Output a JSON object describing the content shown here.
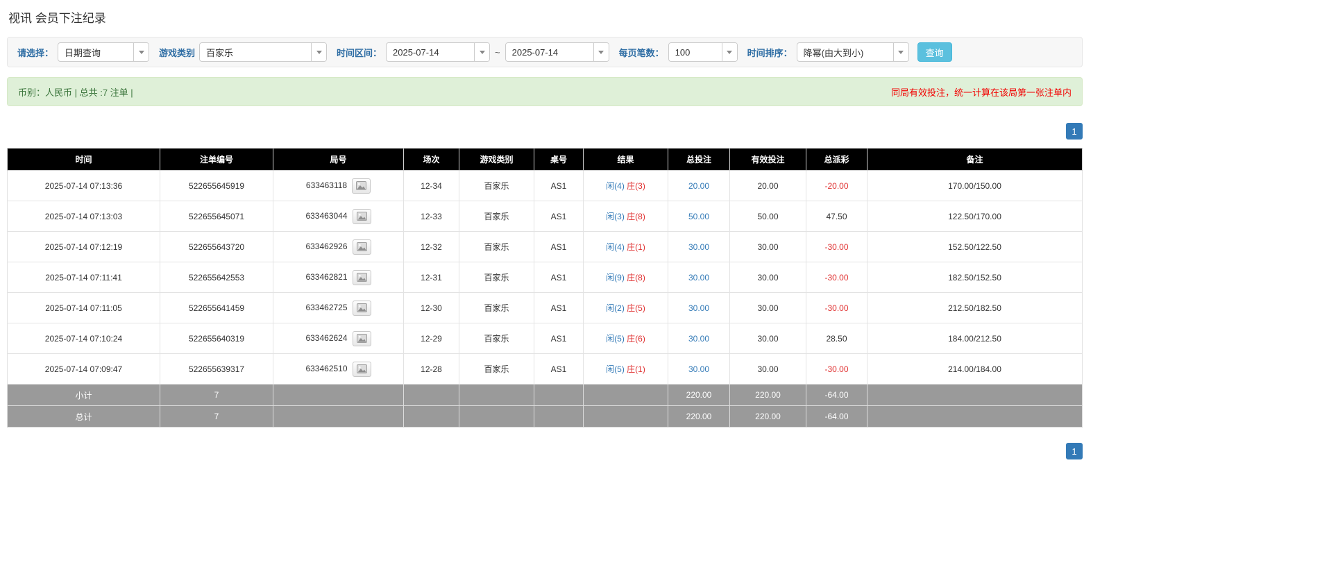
{
  "page": {
    "title": "视讯 会员下注纪录"
  },
  "filters": {
    "query_type": {
      "label": "请选择：",
      "value": "日期查询"
    },
    "game_type": {
      "label": "游戏类别",
      "value": "百家乐"
    },
    "date_range": {
      "label": "时间区间：",
      "from": "2025-07-14",
      "separator": "~",
      "to": "2025-07-14"
    },
    "per_page": {
      "label": "每页笔数：",
      "value": "100"
    },
    "sort": {
      "label": "时间排序：",
      "value": "降幂(由大到小)"
    },
    "search_button": "查询"
  },
  "summary_bar": {
    "left_text": "币别：人民币 | 总共 :7 注单 |",
    "right_note": "同局有效投注，统一计算在该局第一张注单内"
  },
  "pagination": {
    "current_page": "1"
  },
  "table": {
    "headers": [
      "时间",
      "注单编号",
      "局号",
      "场次",
      "游戏类别",
      "桌号",
      "结果",
      "总投注",
      "有效投注",
      "总派彩",
      "备注"
    ],
    "rows": [
      {
        "time": "2025-07-14 07:13:36",
        "bet_id": "522655645919",
        "round": "633463118",
        "session": "12-34",
        "game": "百家乐",
        "table_no": "AS1",
        "result_player": "闲(4)",
        "result_banker": "庄(3)",
        "total_bet": "20.00",
        "valid_bet": "20.00",
        "payout": "-20.00",
        "remark": "170.00/150.00"
      },
      {
        "time": "2025-07-14 07:13:03",
        "bet_id": "522655645071",
        "round": "633463044",
        "session": "12-33",
        "game": "百家乐",
        "table_no": "AS1",
        "result_player": "闲(3)",
        "result_banker": "庄(8)",
        "total_bet": "50.00",
        "valid_bet": "50.00",
        "payout": "47.50",
        "remark": "122.50/170.00"
      },
      {
        "time": "2025-07-14 07:12:19",
        "bet_id": "522655643720",
        "round": "633462926",
        "session": "12-32",
        "game": "百家乐",
        "table_no": "AS1",
        "result_player": "闲(4)",
        "result_banker": "庄(1)",
        "total_bet": "30.00",
        "valid_bet": "30.00",
        "payout": "-30.00",
        "remark": "152.50/122.50"
      },
      {
        "time": "2025-07-14 07:11:41",
        "bet_id": "522655642553",
        "round": "633462821",
        "session": "12-31",
        "game": "百家乐",
        "table_no": "AS1",
        "result_player": "闲(9)",
        "result_banker": "庄(8)",
        "total_bet": "30.00",
        "valid_bet": "30.00",
        "payout": "-30.00",
        "remark": "182.50/152.50"
      },
      {
        "time": "2025-07-14 07:11:05",
        "bet_id": "522655641459",
        "round": "633462725",
        "session": "12-30",
        "game": "百家乐",
        "table_no": "AS1",
        "result_player": "闲(2)",
        "result_banker": "庄(5)",
        "total_bet": "30.00",
        "valid_bet": "30.00",
        "payout": "-30.00",
        "remark": "212.50/182.50"
      },
      {
        "time": "2025-07-14 07:10:24",
        "bet_id": "522655640319",
        "round": "633462624",
        "session": "12-29",
        "game": "百家乐",
        "table_no": "AS1",
        "result_player": "闲(5)",
        "result_banker": "庄(6)",
        "total_bet": "30.00",
        "valid_bet": "30.00",
        "payout": "28.50",
        "remark": "184.00/212.50"
      },
      {
        "time": "2025-07-14 07:09:47",
        "bet_id": "522655639317",
        "round": "633462510",
        "session": "12-28",
        "game": "百家乐",
        "table_no": "AS1",
        "result_player": "闲(5)",
        "result_banker": "庄(1)",
        "total_bet": "30.00",
        "valid_bet": "30.00",
        "payout": "-30.00",
        "remark": "214.00/184.00"
      }
    ],
    "subtotal_row": {
      "label": "小计",
      "count": "7",
      "total_bet": "220.00",
      "valid_bet": "220.00",
      "payout": "-64.00"
    },
    "total_row": {
      "label": "总计",
      "count": "7",
      "total_bet": "220.00",
      "valid_bet": "220.00",
      "payout": "-64.00"
    }
  },
  "icons": {
    "combo_caret": "caret-down",
    "round_media_button": "video-replay"
  },
  "colors": {
    "link_blue": "#337ab7",
    "player_blue": "#337ab7",
    "banker_red": "#e03131",
    "negative_red": "#e03131",
    "header_bg": "#000000",
    "footer_bg": "#9a9a9a",
    "alert_bg": "#dff0d8",
    "alert_note_red": "#f20000",
    "query_button_bg": "#5bc0de",
    "pager_bg": "#337ab7",
    "filter_label_blue": "#2e6da4"
  }
}
